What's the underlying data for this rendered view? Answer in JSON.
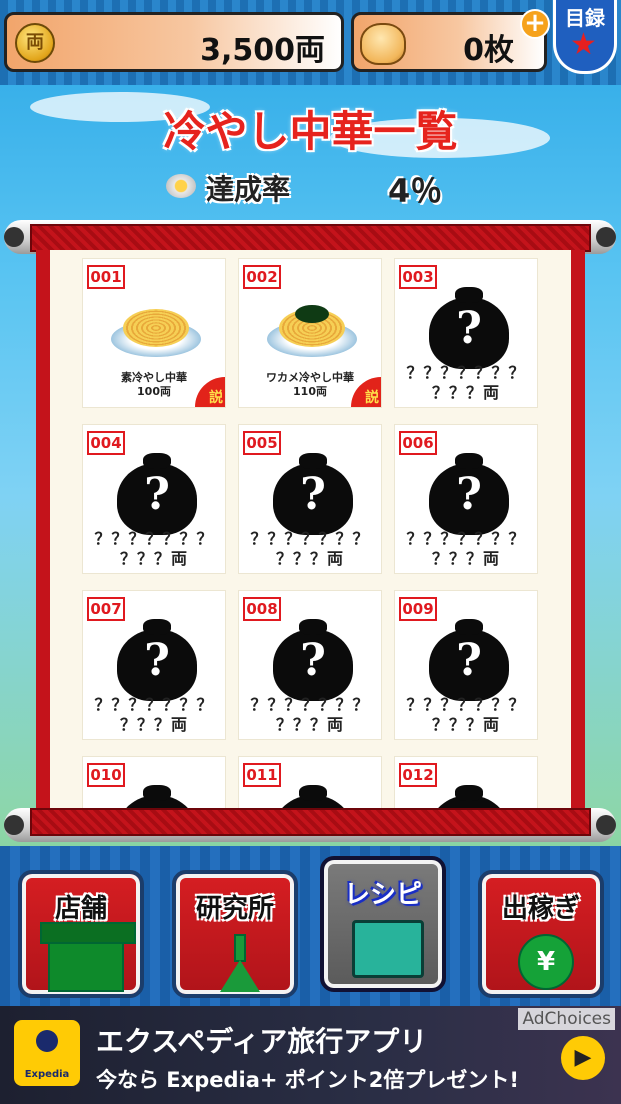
{
  "header": {
    "money": "3,500両",
    "coin_icon_text": "両",
    "tickets": "0枚",
    "catalog_label": "目録"
  },
  "title": "冷やし中華一覧",
  "completion": {
    "label": "達成率",
    "value": "4％"
  },
  "items": [
    {
      "num": "001",
      "name": "素冷やし中華",
      "price": "100両",
      "known": true,
      "badge": "説"
    },
    {
      "num": "002",
      "name": "ワカメ冷やし中華",
      "price": "110両",
      "known": true,
      "badge": "説"
    },
    {
      "num": "003",
      "name": "？？？？？？？",
      "price": "？？？両",
      "known": false
    },
    {
      "num": "004",
      "name": "？？？？？？？",
      "price": "？？？両",
      "known": false
    },
    {
      "num": "005",
      "name": "？？？？？？？",
      "price": "？？？両",
      "known": false
    },
    {
      "num": "006",
      "name": "？？？？？？？",
      "price": "？？？両",
      "known": false
    },
    {
      "num": "007",
      "name": "？？？？？？？",
      "price": "？？？両",
      "known": false
    },
    {
      "num": "008",
      "name": "？？？？？？？",
      "price": "？？？両",
      "known": false
    },
    {
      "num": "009",
      "name": "？？？？？？？",
      "price": "？？？両",
      "known": false
    },
    {
      "num": "010",
      "name": "",
      "price": "",
      "known": false
    },
    {
      "num": "011",
      "name": "",
      "price": "",
      "known": false
    },
    {
      "num": "012",
      "name": "",
      "price": "",
      "known": false
    }
  ],
  "nav": [
    {
      "label": "店舗",
      "icon": "shop-icon"
    },
    {
      "label": "研究所",
      "icon": "flask-icon"
    },
    {
      "label": "レシピ",
      "icon": "book-icon",
      "active": true
    },
    {
      "label": "出稼ぎ",
      "icon": "money-bag-icon"
    }
  ],
  "money_bag_symbol": "¥",
  "ad": {
    "headline": "エクスペディア旅行アプリ",
    "sub": "今なら Expedia+ ポイント2倍プレゼント!",
    "choices": "AdChoices",
    "logo_text": "Expedia"
  }
}
